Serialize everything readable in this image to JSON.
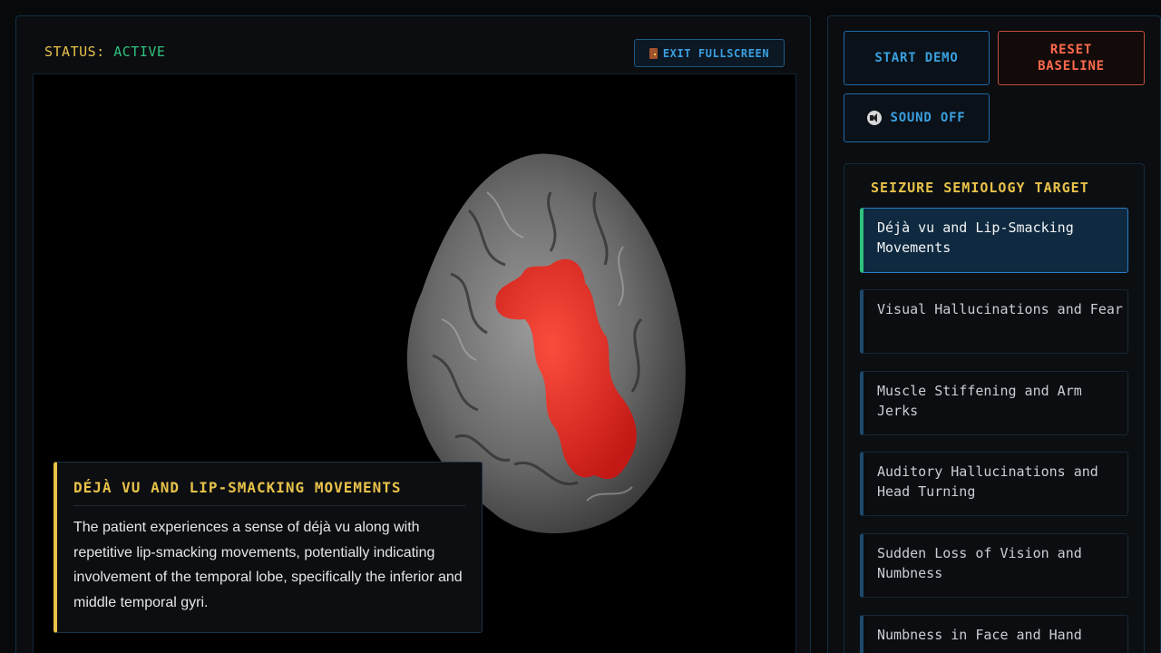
{
  "header": {
    "status_label": "STATUS:",
    "status_value": "ACTIVE",
    "exit_fullscreen_label": "EXIT FULLSCREEN"
  },
  "info_card": {
    "title": "DÉJÀ VU AND LIP-SMACKING MOVEMENTS",
    "description": "The patient experiences a sense of déjà vu along with repetitive lip-smacking movements, potentially indicating involvement of the temporal lobe, specifically the inferior and middle temporal gyri."
  },
  "controls": {
    "start_demo_label": "START DEMO",
    "reset_baseline_label": "RESET BASELINE",
    "sound_label": "SOUND OFF"
  },
  "semiology": {
    "title": "SEIZURE SEMIOLOGY TARGET",
    "items": [
      {
        "label": "Déjà vu and Lip-Smacking Movements",
        "active": true
      },
      {
        "label": "Visual Hallucinations and Fear",
        "active": false
      },
      {
        "label": "Muscle Stiffening and Arm Jerks",
        "active": false
      },
      {
        "label": "Auditory Hallucinations and Head Turning",
        "active": false
      },
      {
        "label": "Sudden Loss of Vision and Numbness",
        "active": false
      },
      {
        "label": "Numbness in Face and Hand",
        "active": false
      }
    ]
  },
  "colors": {
    "accent_yellow": "#e8c24a",
    "accent_blue": "#3aa0e0",
    "status_green": "#2ec27e",
    "reset_red": "#ff6a4d",
    "highlight_region": "#e8211f"
  },
  "icons": {
    "exit": "door-icon",
    "sound": "mute-speaker-icon"
  }
}
